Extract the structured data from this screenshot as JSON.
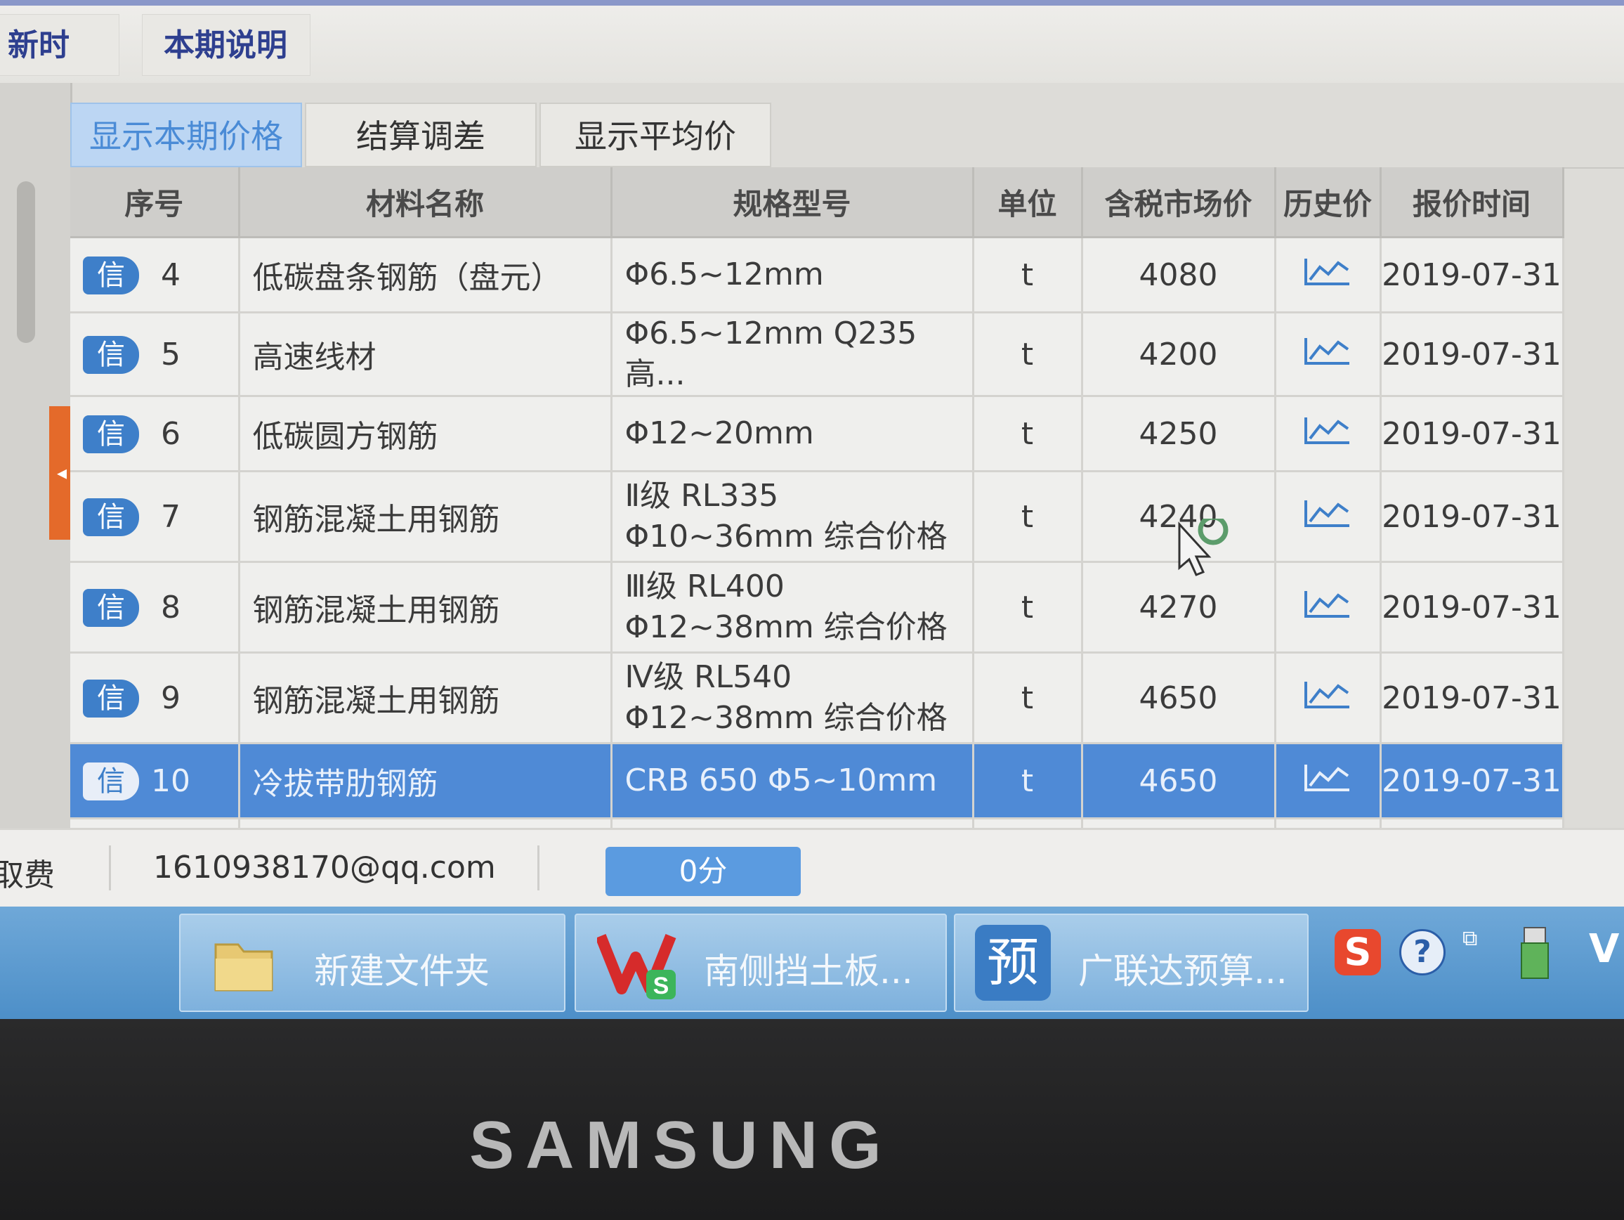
{
  "top_tabs": [
    "新时间",
    "本期说明"
  ],
  "sub_tabs": [
    "显示本期价格",
    "结算调差",
    "显示平均价"
  ],
  "table": {
    "headers": [
      "序号",
      "材料名称",
      "规格型号",
      "单位",
      "含税市场价",
      "历史价",
      "报价时间"
    ],
    "badge": "信",
    "rows": [
      {
        "seq": "4",
        "name": "低碳盘条钢筋（盘元）",
        "spec": [
          "Φ6.5~12mm"
        ],
        "unit": "t",
        "price": "4080",
        "date": "2019-07-31"
      },
      {
        "seq": "5",
        "name": "高速线材",
        "spec": [
          "Φ6.5~12mm Q235  高..."
        ],
        "unit": "t",
        "price": "4200",
        "date": "2019-07-31"
      },
      {
        "seq": "6",
        "name": "低碳圆方钢筋",
        "spec": [
          "Φ12~20mm"
        ],
        "unit": "t",
        "price": "4250",
        "date": "2019-07-31"
      },
      {
        "seq": "7",
        "name": "钢筋混凝土用钢筋",
        "spec": [
          "Ⅱ级 RL335",
          "Φ10~36mm  综合价格"
        ],
        "unit": "t",
        "price": "4240",
        "date": "2019-07-31"
      },
      {
        "seq": "8",
        "name": "钢筋混凝土用钢筋",
        "spec": [
          "Ⅲ级 RL400",
          "Φ12~38mm  综合价格"
        ],
        "unit": "t",
        "price": "4270",
        "date": "2019-07-31"
      },
      {
        "seq": "9",
        "name": "钢筋混凝土用钢筋",
        "spec": [
          "Ⅳ级 RL540",
          "Φ12~38mm  综合价格"
        ],
        "unit": "t",
        "price": "4650",
        "date": "2019-07-31"
      },
      {
        "seq": "10",
        "name": "冷拔带肋钢筋",
        "spec": [
          "CRB 650 Φ5~10mm"
        ],
        "unit": "t",
        "price": "4650",
        "date": "2019-07-31"
      }
    ],
    "selected_row": 6
  },
  "status_bar": {
    "left_label": "取费",
    "email": "1610938170@qq.com",
    "points_button": "0分"
  },
  "taskbar": {
    "items": [
      {
        "label": "新建文件夹",
        "icon": "folder-icon"
      },
      {
        "label": "南侧挡土板...",
        "icon": "wps-icon"
      },
      {
        "label": "广联达预算...",
        "icon": "budget-icon",
        "icon_text": "预"
      }
    ],
    "tray_icons": [
      "sogou-icon",
      "help-icon",
      "network-icon",
      "usb-icon",
      "wps-tray-icon"
    ],
    "tray_text": {
      "sogou": "S",
      "help": "?"
    }
  },
  "bezel": {
    "brand": "SAMSUNG"
  },
  "colors": {
    "accent": "#4f8ad6",
    "badge": "#3e7fc9",
    "taskbar": "#5b9ad0",
    "orange_handle": "#e46a2a"
  }
}
